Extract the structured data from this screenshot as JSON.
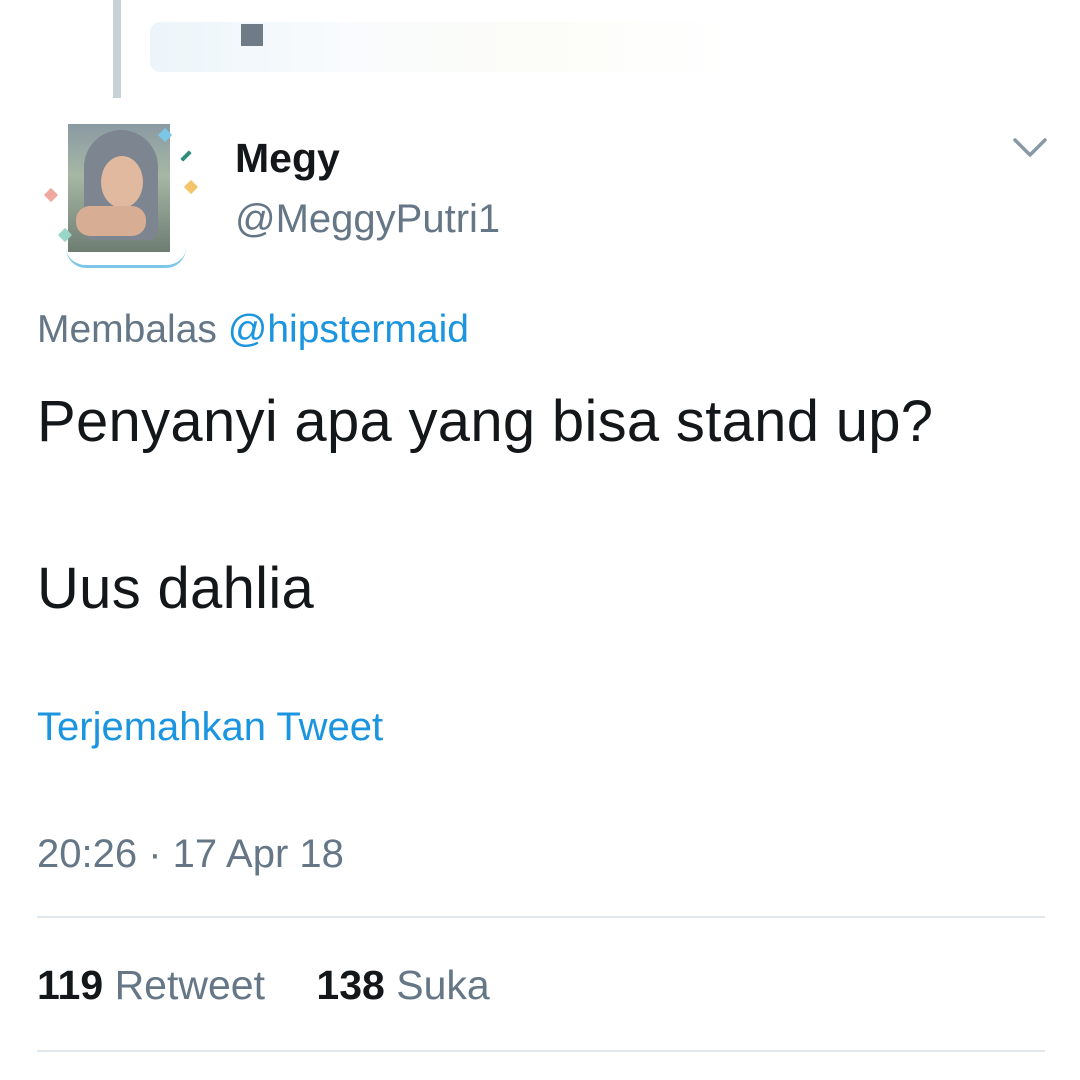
{
  "tweet": {
    "author_name": "Megy",
    "author_handle": "@MeggyPutri1",
    "reply_prefix": "Membalas",
    "reply_mention": "@hipstermaid",
    "text_line_1": "Penyanyi apa yang bisa stand up?",
    "text_line_2": "Uus dahlia",
    "translate_label": "Terjemahkan Tweet",
    "timestamp": "20:26 · 17 Apr 18"
  },
  "stats": {
    "retweets_count": "119",
    "retweets_label": "Retweet",
    "likes_count": "138",
    "likes_label": "Suka"
  },
  "icons": {
    "menu": "chevron-down-icon",
    "avatar": "avatar"
  },
  "colors": {
    "link_blue": "#1b95e0",
    "secondary_gray": "#657786",
    "primary_text": "#14171a",
    "divider": "#e1e8ed"
  }
}
